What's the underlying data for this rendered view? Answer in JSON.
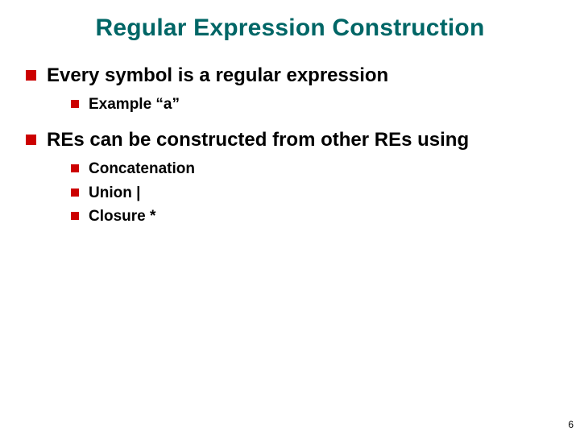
{
  "title": "Regular Expression Construction",
  "bullets": [
    {
      "text": "Every symbol is a regular expression",
      "children": [
        {
          "text": "Example “a”"
        }
      ]
    },
    {
      "text": "REs can be constructed from other REs using",
      "children": [
        {
          "text": "Concatenation"
        },
        {
          "text": "Union |"
        },
        {
          "text": "Closure *"
        }
      ]
    }
  ],
  "page_number": "6"
}
